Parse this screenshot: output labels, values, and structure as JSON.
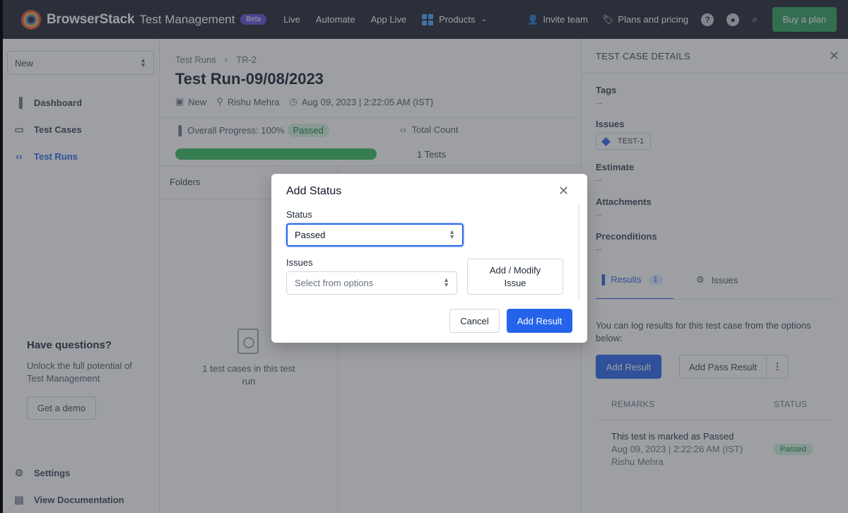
{
  "topbar": {
    "brand": "BrowserStack",
    "product": "Test Management",
    "beta": "Beta",
    "nav": [
      "Live",
      "Automate",
      "App Live"
    ],
    "products": "Products",
    "invite": "Invite team",
    "plans": "Plans and pricing",
    "buy": "Buy a plan"
  },
  "sidebar": {
    "project": "New",
    "items": [
      {
        "label": "Dashboard",
        "icon": "bar-chart-icon"
      },
      {
        "label": "Test Cases",
        "icon": "folder-icon"
      },
      {
        "label": "Test Runs",
        "icon": "code-icon"
      }
    ],
    "help_title": "Have questions?",
    "help_text": "Unlock the full potential of Test Management",
    "demo": "Get a demo",
    "settings": "Settings",
    "docs": "View Documentation"
  },
  "main": {
    "breadcrumb": [
      "Test Runs",
      "TR-2"
    ],
    "title": "Test Run-09/08/2023",
    "status": "New",
    "user": "Rishu Mehra",
    "datetime": "Aug 09, 2023 | 2:22:05 AM (IST)",
    "progress_label": "Overall Progress: 100%",
    "progress_status": "Passed",
    "progress_value": 1.0,
    "total_label": "Total Count",
    "total_value": "1 Tests",
    "folders": "Folders",
    "empty_text": "1 test cases in this test run"
  },
  "details": {
    "title": "TEST CASE DETAILS",
    "tags_label": "Tags",
    "tags_value": "--",
    "issues_label": "Issues",
    "issue_chip": "TEST-1",
    "estimate_label": "Estimate",
    "estimate_value": "--",
    "attachments_label": "Attachments",
    "attachments_value": "--",
    "preconditions_label": "Preconditions",
    "preconditions_value": "--",
    "tab_results": "Results",
    "tab_results_count": "1",
    "tab_issues": "Issues",
    "desc": "You can log results for this test case from the options below:",
    "add_result": "Add Result",
    "add_pass": "Add Pass Result",
    "col_remarks": "REMARKS",
    "col_status": "STATUS",
    "row_title": "This test is marked as Passed",
    "row_date": "Aug 09, 2023 | 2:22:26 AM (IST)",
    "row_user": "Rishu Mehra",
    "row_status": "Passed"
  },
  "modal": {
    "title": "Add Status",
    "status_label": "Status",
    "status_value": "Passed",
    "issues_label": "Issues",
    "issues_placeholder": "Select from options",
    "modify_label": "Add / Modify Issue",
    "cancel": "Cancel",
    "submit": "Add Result"
  }
}
